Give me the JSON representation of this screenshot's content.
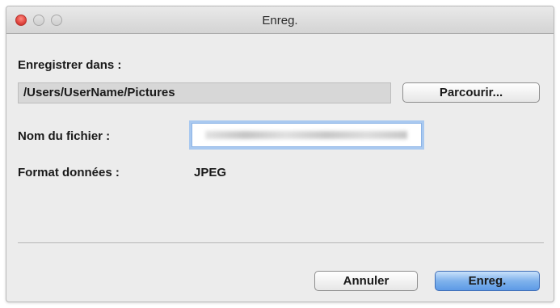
{
  "window": {
    "title": "Enreg."
  },
  "save_in": {
    "label": "Enregistrer dans :",
    "path": "/Users/UserName/Pictures",
    "browse_button": "Parcourir..."
  },
  "file_name": {
    "label": "Nom du fichier :",
    "value": ""
  },
  "data_format": {
    "label": "Format données :",
    "value": "JPEG"
  },
  "buttons": {
    "cancel": "Annuler",
    "save": "Enreg."
  }
}
